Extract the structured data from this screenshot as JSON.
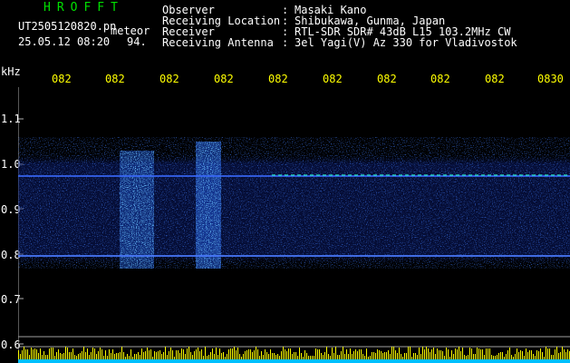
{
  "header": {
    "brand": "HROFFT",
    "filename": "UT2505120820.pn",
    "meteor_label": "meteor",
    "datetime": "25.05.12 08:20",
    "count": "94."
  },
  "info": [
    {
      "key": "Observer",
      "sep": ":",
      "value": "Masaki Kano"
    },
    {
      "key": "Receiving Location",
      "sep": ":",
      "value": "Shibukawa, Gunma, Japan"
    },
    {
      "key": "Receiver",
      "sep": ":",
      "value": "RTL-SDR SDR# 43dB L15 103.2MHz CW"
    },
    {
      "key": "Receiving Antenna",
      "sep": ":",
      "value": "3el Yagi(V) Az 330 for Vladivostok"
    }
  ],
  "time_axis": {
    "labels": [
      "082",
      "082",
      "082",
      "082",
      "082",
      "082",
      "082",
      "082",
      "082",
      "0830"
    ]
  },
  "y_axis": {
    "unit": "kHz",
    "labels": [
      "1.1",
      "1.0",
      "0.9",
      "0.8",
      "0.7",
      "0.6"
    ]
  },
  "colors": {
    "time_label": "#ffff00",
    "brand": "#00e000",
    "text": "#ffffff",
    "axis": "#b0b0b0",
    "signal": "#1a3fd6",
    "meteor_head": "#00ffff",
    "bar_low": "#00bfff",
    "bar_high": "#ffff00"
  }
}
